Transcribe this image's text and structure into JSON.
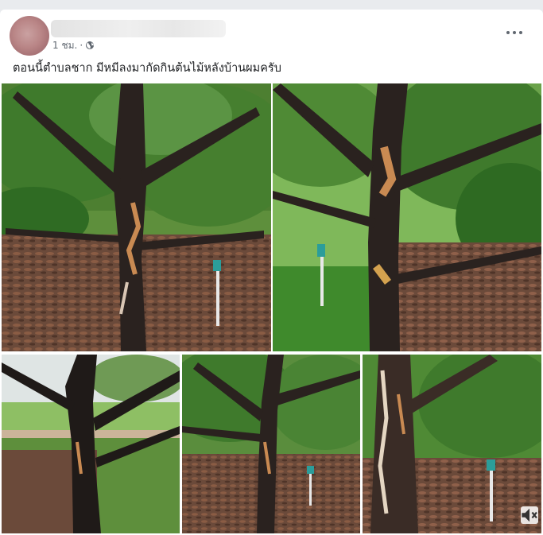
{
  "post": {
    "time": "1 ชม.",
    "separator": "·",
    "privacy_icon": "globe-icon",
    "more_icon": "more-options-icon",
    "caption": "ตอนนี้ตำบลชาก มีหมีลงมากัดกินต้นไม้หลังบ้านผมครับ"
  },
  "colors": {
    "page_bg": "#e9ebee",
    "card_bg": "#ffffff",
    "meta_text": "#606770",
    "caption_text": "#1c1e21",
    "foliage": "#3e7a2a",
    "bark": "#2a221f",
    "bark_wound": "#c98a52",
    "leaf_litter": "#6b4a3a"
  },
  "photos": [
    {
      "id": "photo-1",
      "scene": "tree-with-clawed-trunk"
    },
    {
      "id": "photo-2",
      "scene": "tree-with-clawed-trunk-and-sprinkler"
    },
    {
      "id": "photo-3",
      "scene": "tree-in-open-field"
    },
    {
      "id": "photo-4",
      "scene": "tree-with-sprinkler"
    },
    {
      "id": "photo-5",
      "scene": "trunk-closeup-with-sprinkler"
    }
  ]
}
